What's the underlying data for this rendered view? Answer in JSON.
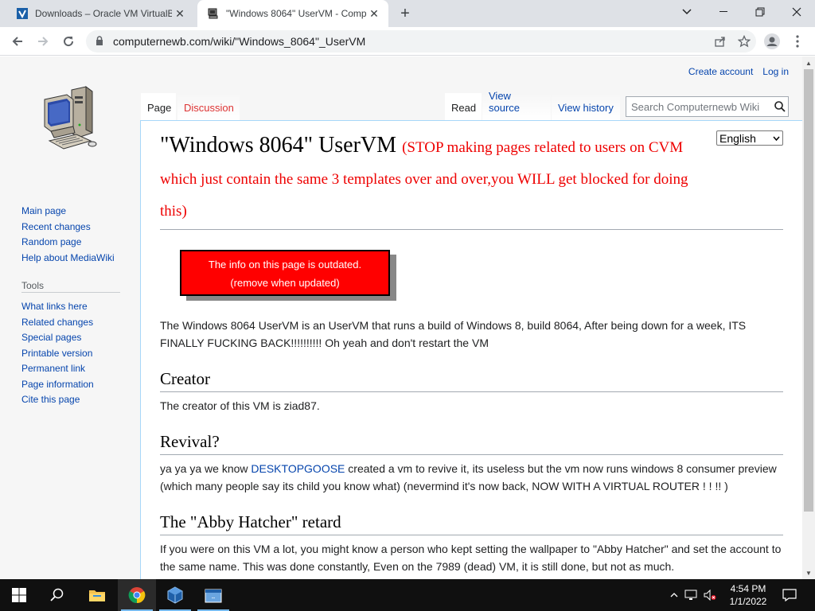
{
  "browser": {
    "tabs": [
      {
        "title": "Downloads – Oracle VM VirtualB",
        "active": false
      },
      {
        "title": "\"Windows 8064\" UserVM - Comp",
        "active": true
      }
    ],
    "url": "computernewb.com/wiki/\"Windows_8064\"_UserVM"
  },
  "wiki": {
    "personal": {
      "create_account": "Create account",
      "log_in": "Log in"
    },
    "tabs": {
      "page": "Page",
      "discussion": "Discussion",
      "read": "Read",
      "view_source": "View source",
      "view_history": "View history"
    },
    "search_placeholder": "Search Computernewb Wiki",
    "navigation": [
      "Main page",
      "Recent changes",
      "Random page",
      "Help about MediaWiki"
    ],
    "tools_heading": "Tools",
    "tools": [
      "What links here",
      "Related changes",
      "Special pages",
      "Printable version",
      "Permanent link",
      "Page information",
      "Cite this page"
    ],
    "language": "English"
  },
  "article": {
    "title": "\"Windows 8064\" UserVM",
    "title_warning": "(STOP making pages related to users on CVM which just contain the same 3 templates over and over,you WILL get blocked for doing this)",
    "outdated_line1": "The info on this page is outdated.",
    "outdated_line2": "(remove when updated)",
    "intro": "The Windows 8064 UserVM is an UserVM that runs a build of Windows 8, build 8064, After being down for a week, ITS FINALLY FUCKING BACK!!!!!!!!!! Oh yeah and don't restart the VM",
    "sections": [
      {
        "heading": "Creator",
        "text": "The creator of this VM is ziad87."
      },
      {
        "heading": "Revival?",
        "text_before": "ya ya ya we know ",
        "link": "DESKTOPGOOSE",
        "text_after": " created a vm to revive it, its useless but the vm now runs windows 8 consumer preview (which many people say its child you know what) (nevermind it's now back, NOW WITH A VIRTUAL ROUTER ! ! !! )"
      },
      {
        "heading": "The \"Abby Hatcher\" retard",
        "text": "If you were on this VM a lot, you might know a person who kept setting the wallpaper to \"Abby Hatcher\" and set the account to the same name. This was done constantly, Even on the 7989 (dead) VM, it is still done, but not as much."
      }
    ]
  },
  "taskbar": {
    "time": "4:54 PM",
    "date": "1/1/2022"
  },
  "colors": {
    "link": "#0645ad",
    "warning_red": "#e00000",
    "outdated_box": "#ff0000",
    "taskbar": "#101010"
  }
}
